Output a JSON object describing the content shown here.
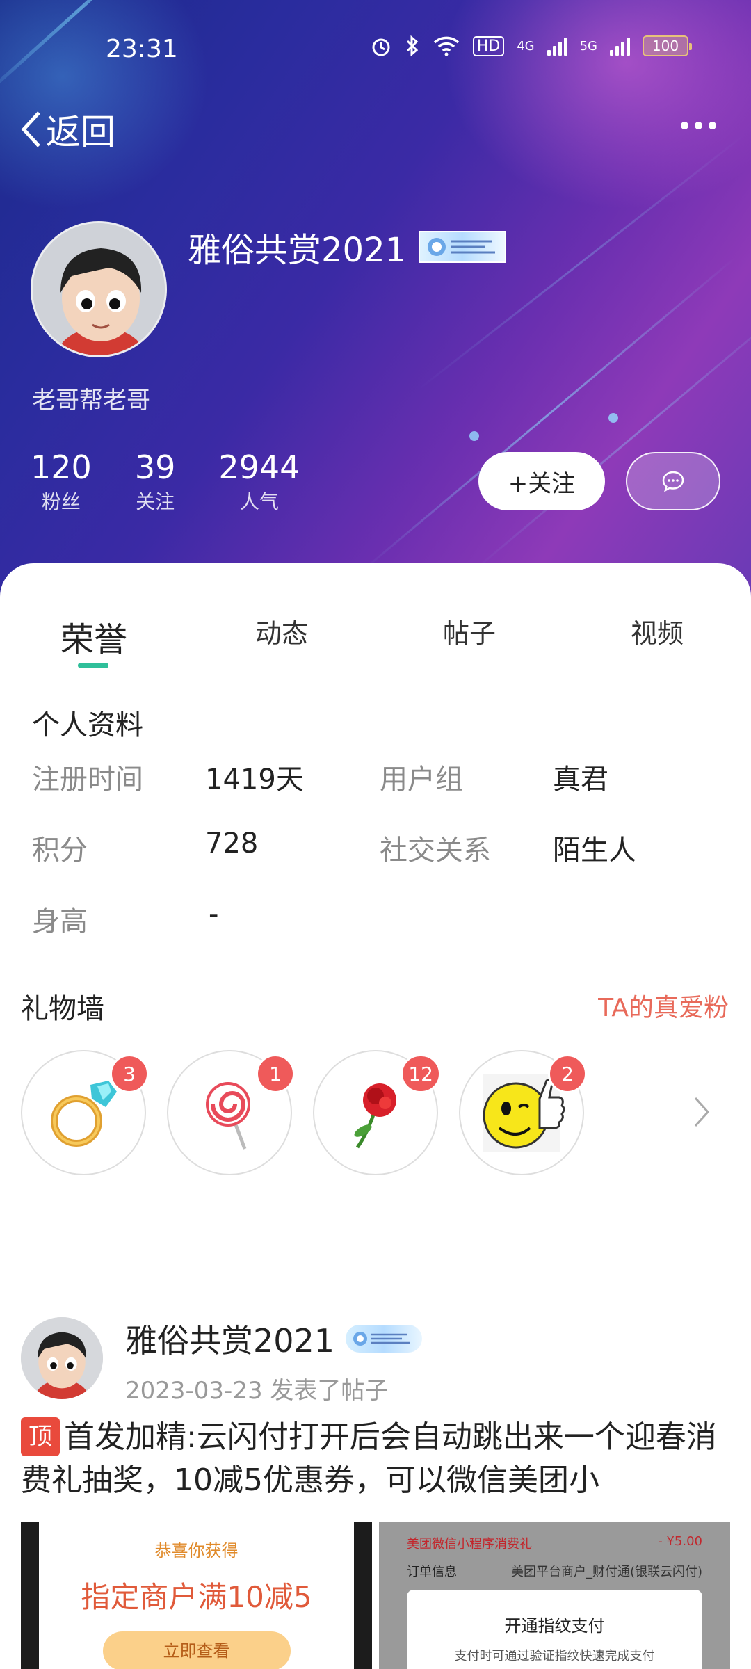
{
  "status_bar": {
    "time": "23:31",
    "network_hd": "HD",
    "network_4g": "4G",
    "network_5g": "5G",
    "battery": "100"
  },
  "nav": {
    "back_label": "返回"
  },
  "profile": {
    "name": "雅俗共赏2021",
    "subtitle": "老哥帮老哥",
    "stats": [
      {
        "value": "120",
        "label": "粉丝"
      },
      {
        "value": "39",
        "label": "关注"
      },
      {
        "value": "2944",
        "label": "人气"
      }
    ],
    "follow_label": "+关注"
  },
  "tabs": [
    {
      "label": "荣誉",
      "active": true
    },
    {
      "label": "动态",
      "active": false
    },
    {
      "label": "帖子",
      "active": false
    },
    {
      "label": "视频",
      "active": false
    }
  ],
  "personal_info": {
    "title": "个人资料",
    "rows": [
      [
        {
          "key": "注册时间",
          "value": "1419天"
        },
        {
          "key": "用户组",
          "value": "真君"
        }
      ],
      [
        {
          "key": "积分",
          "value": "728"
        },
        {
          "key": "社交关系",
          "value": "陌生人"
        }
      ],
      [
        {
          "key": "身高",
          "value": "-"
        }
      ]
    ]
  },
  "gift_wall": {
    "title": "礼物墙",
    "link": "TA的真爱粉",
    "gifts": [
      {
        "icon": "ring-icon",
        "count": "3"
      },
      {
        "icon": "lollipop-icon",
        "count": "1"
      },
      {
        "icon": "rose-icon",
        "count": "12"
      },
      {
        "icon": "thumbs-up-smiley-icon",
        "count": "2"
      }
    ]
  },
  "post": {
    "user": "雅俗共赏2021",
    "meta": "2023-03-23  发表了帖子",
    "top_tag": "顶",
    "title": "首发加精:云闪付打开后会自动跳出来一个迎春消费礼抽奖，10减5优惠券，可以微信美团小",
    "thumb1": {
      "small": "恭喜你获得",
      "big": "指定商户满10减5",
      "cta": "立即查看"
    },
    "thumb2": {
      "line1": "美团微信小程序消费礼",
      "line1_right": "- ¥5.00",
      "line2": "订单信息",
      "line2_right": "美团平台商户_财付通(银联云闪付)",
      "dialog_title": "开通指纹支付",
      "dialog_sub": "支付时可通过验证指纹快速完成支付"
    }
  },
  "colors": {
    "accent_tab": "#2fbf9a",
    "gift_link": "#e86a5a",
    "badge_count": "#ef5a5a",
    "top_tag": "#e94a3c"
  }
}
